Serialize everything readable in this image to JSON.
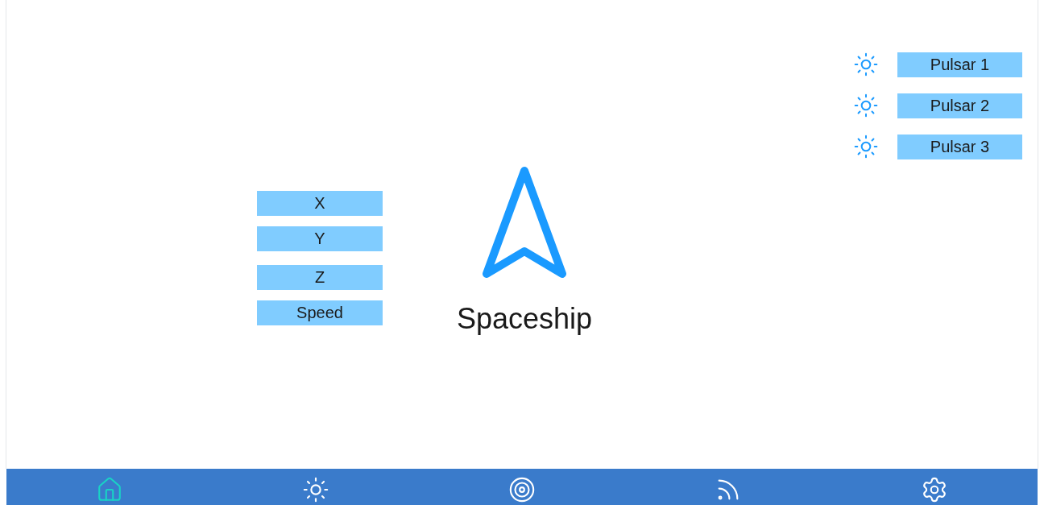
{
  "fields": [
    "X",
    "Y",
    "Z",
    "Speed"
  ],
  "ship": {
    "label": "Spaceship"
  },
  "pulsars": [
    "Pulsar 1",
    "Pulsar 2",
    "Pulsar 3"
  ],
  "nav": [
    {
      "kind": "home",
      "selected": true
    },
    {
      "kind": "sun",
      "selected": false
    },
    {
      "kind": "target",
      "selected": false
    },
    {
      "kind": "feed",
      "selected": false
    },
    {
      "kind": "settings",
      "selected": false
    }
  ]
}
